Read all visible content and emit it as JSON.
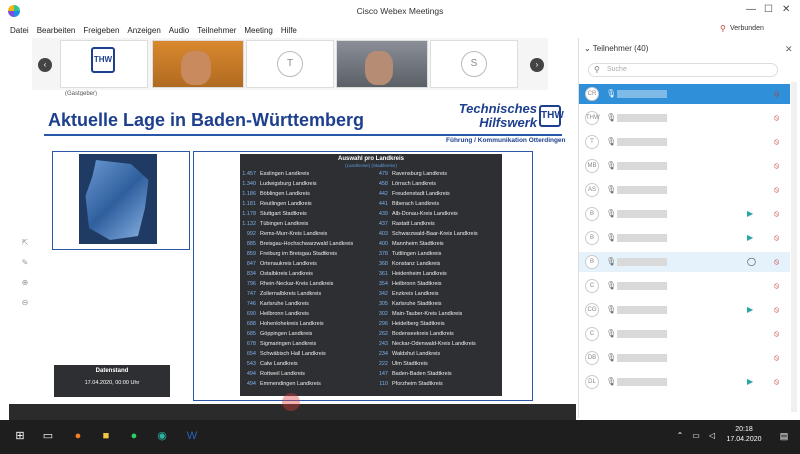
{
  "window": {
    "title": "Cisco Webex Meetings"
  },
  "menu": [
    "Datei",
    "Bearbeiten",
    "Freigeben",
    "Anzeigen",
    "Audio",
    "Teilnehmer",
    "Meeting",
    "Hilfe"
  ],
  "connection": {
    "label": "Verbunden"
  },
  "video_strip": {
    "tiles": [
      {
        "initial": "",
        "name": "(Gastgeber)"
      },
      {
        "initial": "T",
        "name": ""
      },
      {
        "initial": "S",
        "name": ""
      }
    ]
  },
  "slide": {
    "title": "Aktuelle Lage in Baden-Württemberg",
    "org_line1": "Technisches",
    "org_line2": "Hilfswerk",
    "org_sub": "Führung / Kommunikation Otterdingen",
    "emblem": "THW",
    "table_title": "Auswahl pro Landkreis",
    "table_sub": "(Landkreise)  (Stadtkreise)",
    "datenstand_label": "Datenstand",
    "datenstand_value": "17.04.2020, 00:00 Uhr",
    "left_col": [
      {
        "n": "1.457",
        "name": "Esslingen Landkreis"
      },
      {
        "n": "1.340",
        "name": "Ludwigsburg Landkreis"
      },
      {
        "n": "1.186",
        "name": "Böblingen Landkreis"
      },
      {
        "n": "1.181",
        "name": "Reutlingen Landkreis"
      },
      {
        "n": "1.178",
        "name": "Stuttgart Stadtkreis"
      },
      {
        "n": "1.132",
        "name": "Tübingen Landkreis"
      },
      {
        "n": "992",
        "name": "Rems-Murr-Kreis Landkreis"
      },
      {
        "n": "885",
        "name": "Breisgau-Hochschwarzwald Landkreis"
      },
      {
        "n": "859",
        "name": "Freiburg im Breisgau Stadtkreis"
      },
      {
        "n": "847",
        "name": "Ortenaukreis Landkreis"
      },
      {
        "n": "834",
        "name": "Ostalbkreis Landkreis"
      },
      {
        "n": "796",
        "name": "Rhein-Neckar-Kreis Landkreis"
      },
      {
        "n": "747",
        "name": "Zollernalbkreis Landkreis"
      },
      {
        "n": "746",
        "name": "Karlsruhe Landkreis"
      },
      {
        "n": "690",
        "name": "Heilbronn Landkreis"
      },
      {
        "n": "688",
        "name": "Hohenlohekreis Landkreis"
      },
      {
        "n": "685",
        "name": "Göppingen Landkreis"
      },
      {
        "n": "678",
        "name": "Sigmaringen Landkreis"
      },
      {
        "n": "654",
        "name": "Schwäbisch Hall Landkreis"
      },
      {
        "n": "543",
        "name": "Calw Landkreis"
      },
      {
        "n": "494",
        "name": "Rottweil Landkreis"
      },
      {
        "n": "494",
        "name": "Emmendingen Landkreis"
      }
    ],
    "right_col": [
      {
        "n": "479",
        "name": "Ravensburg Landkreis"
      },
      {
        "n": "458",
        "name": "Lörrach Landkreis"
      },
      {
        "n": "442",
        "name": "Freudenstadt Landkreis"
      },
      {
        "n": "441",
        "name": "Biberach Landkreis"
      },
      {
        "n": "439",
        "name": "Alb-Donau-Kreis Landkreis"
      },
      {
        "n": "437",
        "name": "Rastatt Landkreis"
      },
      {
        "n": "403",
        "name": "Schwarzwald-Baar-Kreis Landkreis"
      },
      {
        "n": "400",
        "name": "Mannheim Stadtkreis"
      },
      {
        "n": "378",
        "name": "Tuttlingen Landkreis"
      },
      {
        "n": "368",
        "name": "Konstanz Landkreis"
      },
      {
        "n": "361",
        "name": "Heidenheim Landkreis"
      },
      {
        "n": "354",
        "name": "Heilbronn Stadtkreis"
      },
      {
        "n": "342",
        "name": "Enzkreis Landkreis"
      },
      {
        "n": "305",
        "name": "Karlsruhe Stadtkreis"
      },
      {
        "n": "302",
        "name": "Main-Tauber-Kreis Landkreis"
      },
      {
        "n": "296",
        "name": "Heidelberg Stadtkreis"
      },
      {
        "n": "262",
        "name": "Bodenseekreis Landkreis"
      },
      {
        "n": "243",
        "name": "Neckar-Odenwald-Kreis Landkreis"
      },
      {
        "n": "234",
        "name": "Waldshut Landkreis"
      },
      {
        "n": "222",
        "name": "Ulm Stadtkreis"
      },
      {
        "n": "147",
        "name": "Baden-Baden Stadtkreis"
      },
      {
        "n": "110",
        "name": "Pforzheim Stadtkreis"
      }
    ]
  },
  "participants": {
    "header": "Teilnehmer (40)",
    "search_placeholder": "Suche",
    "rows": [
      {
        "initials": "CR",
        "selected": true
      },
      {
        "initials": "THW"
      },
      {
        "initials": "T"
      },
      {
        "initials": "MB"
      },
      {
        "initials": "AS"
      },
      {
        "initials": "B",
        "video": true
      },
      {
        "initials": "B",
        "video": true
      },
      {
        "initials": "B",
        "highlight": true,
        "chat": true
      },
      {
        "initials": "C"
      },
      {
        "initials": "CG",
        "video": true
      },
      {
        "initials": "C"
      },
      {
        "initials": "DB"
      },
      {
        "initials": "DL",
        "video": true
      }
    ]
  },
  "clock": {
    "time": "20:18",
    "date": "17.04.2020"
  },
  "colors": {
    "brand": "#1d3f8e",
    "selected": "#2f8fd8",
    "muted": "#c0392b"
  }
}
